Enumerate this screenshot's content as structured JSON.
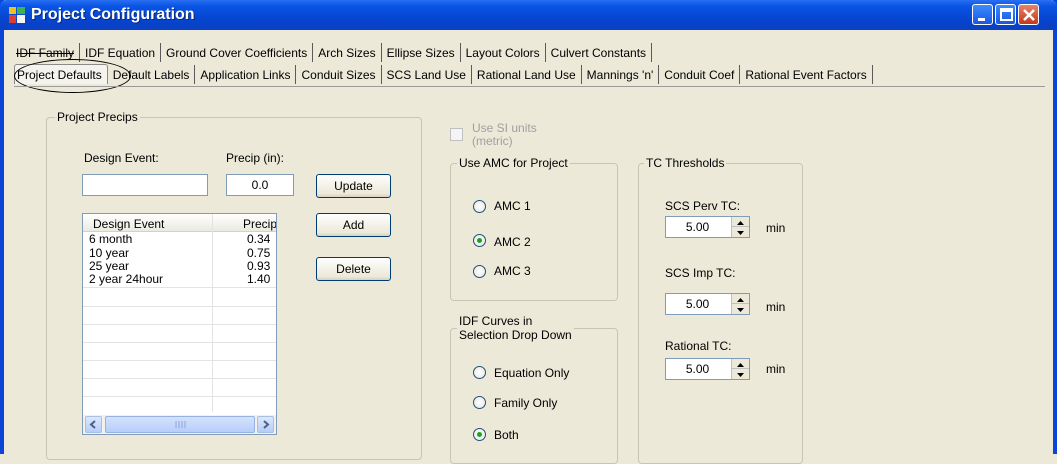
{
  "window": {
    "title": "Project Configuration"
  },
  "tabs_row1": [
    "IDF Family",
    "IDF Equation",
    "Ground Cover Coefficients",
    "Arch Sizes",
    "Ellipse Sizes",
    "Layout Colors",
    "Culvert Constants"
  ],
  "tabs_row2": [
    "Project Defaults",
    "Default Labels",
    "Application Links",
    "Conduit Sizes",
    "SCS Land Use",
    "Rational Land Use",
    "Mannings 'n'",
    "Conduit Coef",
    "Rational Event Factors"
  ],
  "active_tab": "Project Defaults",
  "precips": {
    "legend": "Project Precips",
    "design_event_label": "Design Event:",
    "design_event_value": "",
    "precip_label": "Precip (in):",
    "precip_value": "0.0",
    "buttons": {
      "update": "Update",
      "add": "Add",
      "delete": "Delete"
    },
    "columns": [
      "Design Event",
      "Precip"
    ],
    "rows": [
      {
        "event": "6 month",
        "precip": "0.34"
      },
      {
        "event": "10 year",
        "precip": "0.75"
      },
      {
        "event": "25 year",
        "precip": "0.93"
      },
      {
        "event": "2 year 24hour",
        "precip": "1.40"
      }
    ]
  },
  "si_units": {
    "label_line1": "Use SI units",
    "label_line2": "(metric)",
    "checked": false,
    "enabled": false
  },
  "amc": {
    "legend": "Use AMC for Project",
    "options": [
      "AMC 1",
      "AMC 2",
      "AMC 3"
    ],
    "selected": "AMC 2"
  },
  "idf_curves": {
    "legend_line1": "IDF Curves in",
    "legend_line2": "Selection Drop Down",
    "options": [
      "Equation Only",
      "Family Only",
      "Both"
    ],
    "selected": "Both"
  },
  "tc": {
    "legend": "TC Thresholds",
    "scs_perv_label": "SCS Perv TC:",
    "scs_perv_value": "5.00",
    "scs_imp_label": "SCS Imp TC:",
    "scs_imp_value": "5.00",
    "rational_label": "Rational TC:",
    "rational_value": "5.00",
    "unit": "min"
  },
  "colors": {
    "title_bar": "#0645d0",
    "close_button": "#c4391b",
    "radio_dot": "#21a121"
  }
}
